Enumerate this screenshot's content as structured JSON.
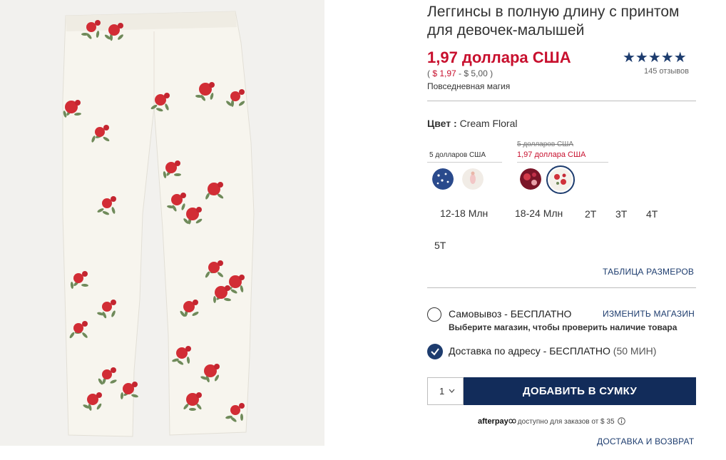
{
  "product": {
    "title": "Леггинсы в полную длину с принтом для девочек-малышей",
    "price": "1,97 доллара США",
    "range_prefix": "( ",
    "range_low": "$ 1,97",
    "range_rest": " - $ 5,00 )",
    "brand": "Повседневная магия",
    "stars": "★★★★★",
    "rating": 5,
    "reviews": "145 отзывов"
  },
  "color": {
    "label": "Цвет :",
    "value": "Cream Floral",
    "group1_price": "5 долларов США",
    "group2_old_price": "5 долларов США",
    "group2_new_price": "1,97 доллара США"
  },
  "sizes": [
    "12-18 Млн",
    "18-24 Млн",
    "2T",
    "3T",
    "4T",
    "5T"
  ],
  "size_chart_link": "ТАБЛИЦА РАЗМЕРОВ",
  "fulfillment": {
    "pickup_label": "Самовывоз - БЕСПЛАТНО",
    "change_store": "ИЗМЕНИТЬ МАГАЗИН",
    "pickup_sub": "Выберите магазин, чтобы проверить наличие товара",
    "ship_label": "Доставка по адресу - БЕСПЛАТНО",
    "ship_min": " (50 МИН)"
  },
  "cart": {
    "qty": "1",
    "add_button": "ДОБАВИТЬ В СУМКУ"
  },
  "afterpay": {
    "brand": "afterpay",
    "text": "доступно для заказов от $ 35"
  },
  "shipping_returns": "ДОСТАВКА И ВОЗВРАТ",
  "colors": {
    "accent_red": "#c8102e",
    "brand_navy": "#1d3c6e",
    "button_navy": "#122c5a"
  }
}
